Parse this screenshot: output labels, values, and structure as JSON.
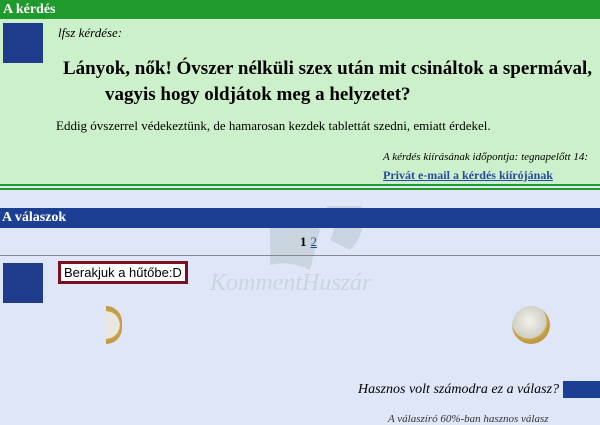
{
  "question_section": {
    "header": "A kérdés",
    "asker_label": "lfsz kérdése:",
    "title_line1": "Lányok, nők! Óvszer nélküli szex után mit csináltok a spermával,",
    "title_line2": "vagyis hogy oldjátok meg a helyzetet?",
    "body": "Eddig óvszerrel védekeztünk, de hamarosan kezdek tablettát szedni, emiatt érdekel.",
    "date_text": "A kérdés kiírásának időpontja: tegnapelőtt 14:",
    "private_email_link": "Privát e-mail a kérdés kiírójának"
  },
  "answers_section": {
    "header": "A válaszok",
    "pages": [
      "1",
      "2"
    ],
    "current_page": "1",
    "answer_text": "Berakjuk a hűtőbe:D",
    "useful_question": "Hasznos volt számodra ez a válasz?",
    "bottom_cut_text": "A válaszíró 60%-ban hasznos válasz"
  },
  "watermark": "KommentHuszár",
  "colors": {
    "question_green": "#1f9a2c",
    "question_bg": "#ccf0c9",
    "answer_blue": "#1c3f94",
    "answer_bg": "#dfe6f8",
    "answer_border": "#7a1020"
  }
}
